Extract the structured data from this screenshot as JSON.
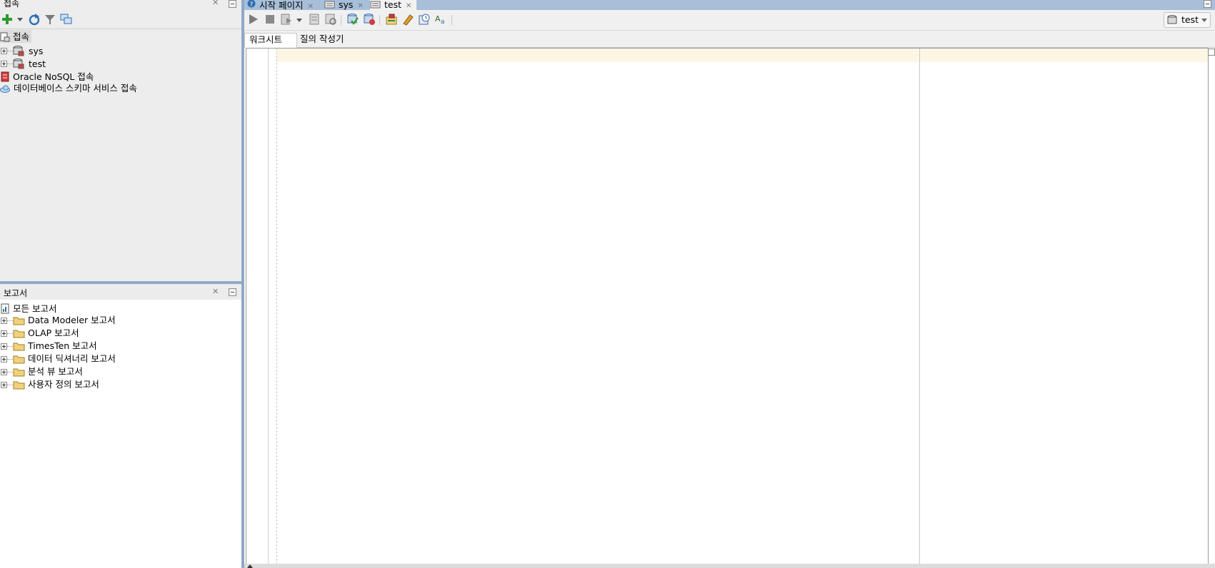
{
  "connections_panel": {
    "title": "접속",
    "tree": {
      "root_label": "접속",
      "items": [
        {
          "label": "sys",
          "expandable": true
        },
        {
          "label": "test",
          "expandable": true
        }
      ],
      "others": [
        {
          "label": "Oracle NoSQL 접속",
          "icon": "nosql-icon"
        },
        {
          "label": "데이터베이스 스키마 서비스 접속",
          "icon": "cloud-icon"
        }
      ]
    },
    "toolbar_icons": [
      "add-icon",
      "dropdown-arrow-icon",
      "refresh-icon",
      "filter-icon",
      "schema-browser-icon"
    ]
  },
  "reports_panel": {
    "title": "보고서",
    "root_label": "모든 보고서",
    "items": [
      {
        "label": "Data Modeler 보고서"
      },
      {
        "label": "OLAP 보고서"
      },
      {
        "label": "TimesTen 보고서"
      },
      {
        "label": "데이터 딕셔너리 보고서"
      },
      {
        "label": "분석 뷰 보고서"
      },
      {
        "label": "사용자 정의 보고서"
      }
    ]
  },
  "editor_tabs": [
    {
      "label": "시작 페이지",
      "icon": "help-icon",
      "active": false
    },
    {
      "label": "sys",
      "icon": "sql-worksheet-icon",
      "active": false
    },
    {
      "label": "test",
      "icon": "sql-worksheet-icon",
      "active": true
    }
  ],
  "worksheet_toolbar": {
    "icons": [
      "run-statement-icon",
      "stop-icon",
      "run-script-icon",
      "dropdown-arrow-icon",
      "autotrace-icon",
      "explain-plan-icon",
      "commit-icon",
      "rollback-icon",
      "unshared-sql-icon",
      "clear-icon",
      "sql-history-icon",
      "format-icon"
    ],
    "connection": "test"
  },
  "worksheet_subtabs": [
    {
      "label": "워크시트",
      "active": true
    },
    {
      "label": "질의 작성기",
      "active": false
    }
  ],
  "colors": {
    "tabbar_bg": "#a7bfd9",
    "splitter": "#8fa9c6",
    "current_line": "#fdf6e4",
    "panel_bg": "#ededed"
  }
}
